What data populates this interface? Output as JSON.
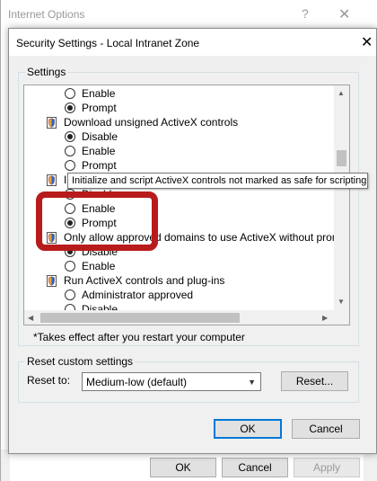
{
  "background_window": {
    "title": "Internet Options",
    "help_glyph": "?",
    "close_glyph": "✕",
    "buttons": {
      "ok": "OK",
      "cancel": "Cancel",
      "apply": "Apply"
    }
  },
  "dialog": {
    "title": "Security Settings - Local Intranet Zone",
    "close_glyph": "✕",
    "settings_group_label": "Settings",
    "settings_tree": [
      {
        "type": "radio",
        "label": "Enable",
        "selected": false
      },
      {
        "type": "radio",
        "label": "Prompt",
        "selected": true
      },
      {
        "type": "category",
        "label": "Download unsigned ActiveX controls",
        "icon": "settings-shield-icon"
      },
      {
        "type": "radio",
        "label": "Disable",
        "selected": true
      },
      {
        "type": "radio",
        "label": "Enable",
        "selected": false
      },
      {
        "type": "radio",
        "label": "Prompt",
        "selected": false
      },
      {
        "type": "category",
        "label": "Initialize and script ActiveX controls not marked as safe for scripting",
        "icon": "settings-shield-icon"
      },
      {
        "type": "radio",
        "label": "Disable",
        "selected": false
      },
      {
        "type": "radio",
        "label": "Enable",
        "selected": false
      },
      {
        "type": "radio",
        "label": "Prompt",
        "selected": true
      },
      {
        "type": "category",
        "label": "Only allow approved domains to use ActiveX without prompt",
        "icon": "settings-shield-icon"
      },
      {
        "type": "radio",
        "label": "Disable",
        "selected": true
      },
      {
        "type": "radio",
        "label": "Enable",
        "selected": false
      },
      {
        "type": "category",
        "label": "Run ActiveX controls and plug-ins",
        "icon": "settings-shield-icon"
      },
      {
        "type": "radio",
        "label": "Administrator approved",
        "selected": false
      },
      {
        "type": "radio",
        "label": "Disable",
        "selected": false
      }
    ],
    "tooltip": "Initialize and script ActiveX controls not marked as safe for scripting",
    "note": "*Takes effect after you restart your computer",
    "reset_group_label": "Reset custom settings",
    "reset_to_label": "Reset to:",
    "reset_level": "Medium-low (default)",
    "reset_button": "Reset...",
    "ok_button": "OK",
    "cancel_button": "Cancel"
  },
  "colors": {
    "annotation_highlight": "#b81b1b",
    "default_button_border": "#0078d7"
  }
}
